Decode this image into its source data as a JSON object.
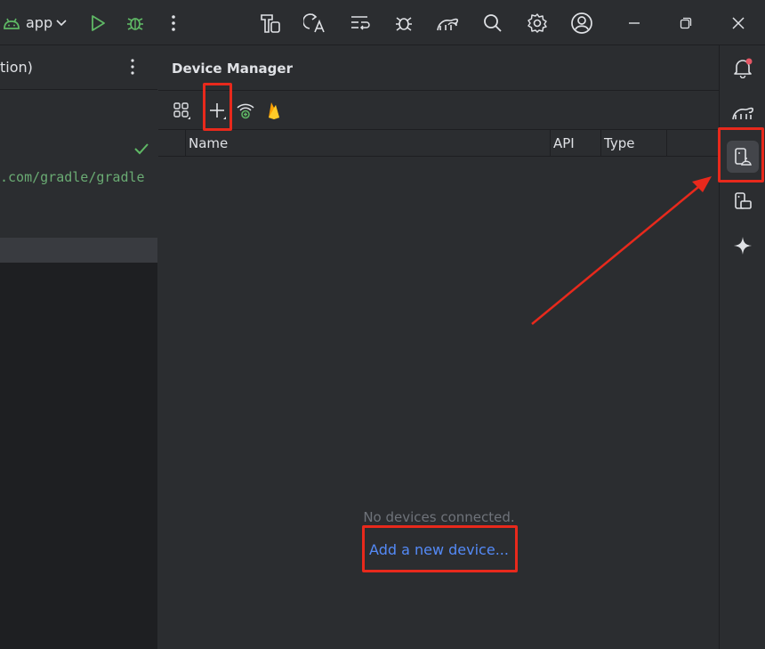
{
  "toolbar": {
    "app_label": "app",
    "icons": [
      "android-icon",
      "chevron-down-icon",
      "run-icon",
      "debug-icon",
      "more-icon",
      "build-icon",
      "apply-changes-icon",
      "sync-icon",
      "profiler-icon",
      "gradle-sync-icon",
      "search-icon",
      "settings-icon",
      "account-icon",
      "minimize-icon",
      "restore-icon",
      "close-icon"
    ]
  },
  "left_panel": {
    "header_text": "tion)",
    "url_text": ".com/gradle/gradle"
  },
  "device_manager": {
    "title": "Device Manager",
    "columns": [
      "Name",
      "API",
      "Type"
    ],
    "empty_message": "No devices connected.",
    "add_link": "Add a new device..."
  },
  "right_bar": {
    "icons": [
      "notifications-icon",
      "gradle-icon",
      "device-manager-icon",
      "running-devices-icon",
      "gemini-icon"
    ]
  },
  "colors": {
    "accent": "#548af7",
    "highlight": "#e8291c",
    "green": "#5fb865",
    "firebase": "#ffa000"
  }
}
